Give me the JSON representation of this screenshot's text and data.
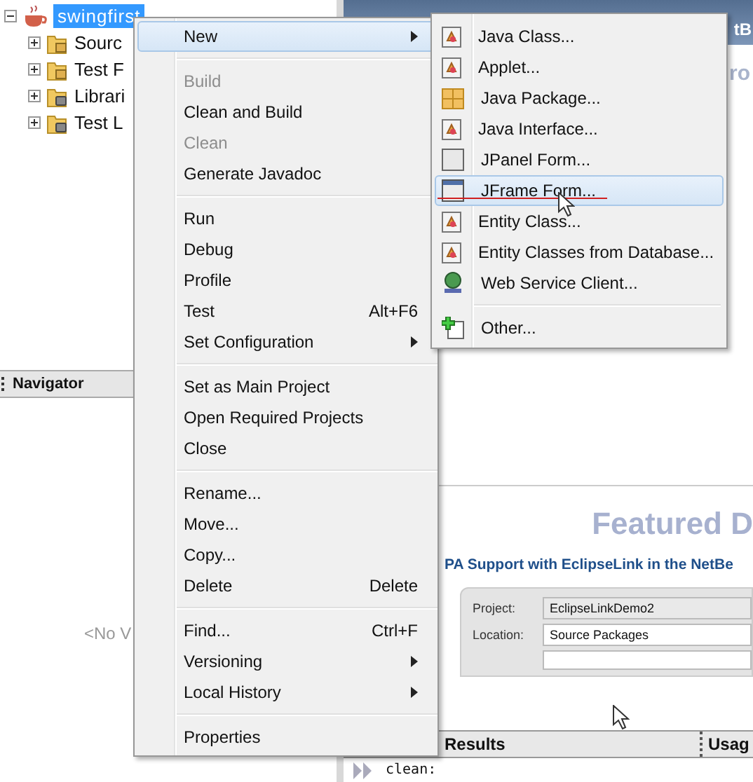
{
  "project_tree": {
    "root": {
      "label": "swingfirst",
      "selected": true,
      "expanded": true
    },
    "children": [
      {
        "kind": "packages",
        "label": "Sourc",
        "expanded": false
      },
      {
        "kind": "packages",
        "label": "Test F",
        "expanded": false
      },
      {
        "kind": "libraries",
        "label": "Librari",
        "expanded": false
      },
      {
        "kind": "libraries",
        "label": "Test L",
        "expanded": false
      }
    ]
  },
  "navigator": {
    "title": "Navigator",
    "empty_text": "<No V"
  },
  "editor": {
    "tab_text": "tB",
    "heading_fragment": "ro",
    "featured_heading": "Featured D",
    "article_title": "PA Support with EclipseLink in the NetBe",
    "form_preview": {
      "fields": [
        {
          "label": "Project:",
          "value": "EclipseLinkDemo2"
        },
        {
          "label": "Location:",
          "value": "Source Packages"
        }
      ]
    }
  },
  "output": {
    "tabs": [
      {
        "label": "Results"
      },
      {
        "label": "Usag"
      }
    ],
    "lines": [
      "clean:"
    ]
  },
  "context_menu": {
    "items": [
      {
        "kind": "item",
        "label": "New",
        "selected": true,
        "disabled": false,
        "submenu": true
      },
      {
        "kind": "separator"
      },
      {
        "kind": "item",
        "label": "Build",
        "selected": false,
        "disabled": true,
        "submenu": false
      },
      {
        "kind": "item",
        "label": "Clean and Build",
        "selected": false,
        "disabled": false,
        "submenu": false
      },
      {
        "kind": "item",
        "label": "Clean",
        "selected": false,
        "disabled": true,
        "submenu": false
      },
      {
        "kind": "item",
        "label": "Generate Javadoc",
        "selected": false,
        "disabled": false,
        "submenu": false
      },
      {
        "kind": "separator"
      },
      {
        "kind": "item",
        "label": "Run",
        "selected": false,
        "disabled": false,
        "submenu": false
      },
      {
        "kind": "item",
        "label": "Debug",
        "selected": false,
        "disabled": false,
        "submenu": false
      },
      {
        "kind": "item",
        "label": "Profile",
        "selected": false,
        "disabled": false,
        "submenu": false
      },
      {
        "kind": "item",
        "label": "Test",
        "shortcut": "Alt+F6",
        "selected": false,
        "disabled": false,
        "submenu": false
      },
      {
        "kind": "item",
        "label": "Set Configuration",
        "selected": false,
        "disabled": false,
        "submenu": true
      },
      {
        "kind": "separator"
      },
      {
        "kind": "item",
        "label": "Set as Main Project",
        "selected": false,
        "disabled": false,
        "submenu": false
      },
      {
        "kind": "item",
        "label": "Open Required Projects",
        "selected": false,
        "disabled": false,
        "submenu": false
      },
      {
        "kind": "item",
        "label": "Close",
        "selected": false,
        "disabled": false,
        "submenu": false
      },
      {
        "kind": "separator"
      },
      {
        "kind": "item",
        "label": "Rename...",
        "selected": false,
        "disabled": false,
        "submenu": false
      },
      {
        "kind": "item",
        "label": "Move...",
        "selected": false,
        "disabled": false,
        "submenu": false
      },
      {
        "kind": "item",
        "label": "Copy...",
        "selected": false,
        "disabled": false,
        "submenu": false
      },
      {
        "kind": "item",
        "label": "Delete",
        "shortcut": "Delete",
        "selected": false,
        "disabled": false,
        "submenu": false
      },
      {
        "kind": "separator"
      },
      {
        "kind": "item",
        "label": "Find...",
        "shortcut": "Ctrl+F",
        "selected": false,
        "disabled": false,
        "submenu": false
      },
      {
        "kind": "item",
        "label": "Versioning",
        "selected": false,
        "disabled": false,
        "submenu": true
      },
      {
        "kind": "item",
        "label": "Local History",
        "selected": false,
        "disabled": false,
        "submenu": true
      },
      {
        "kind": "separator"
      },
      {
        "kind": "item",
        "label": "Properties",
        "selected": false,
        "disabled": false,
        "submenu": false
      }
    ]
  },
  "new_submenu": {
    "items": [
      {
        "kind": "template",
        "label": "Java Class...",
        "selected": false
      },
      {
        "kind": "template",
        "label": "Applet...",
        "selected": false
      },
      {
        "kind": "package",
        "label": "Java Package...",
        "selected": false
      },
      {
        "kind": "template",
        "label": "Java Interface...",
        "selected": false
      },
      {
        "kind": "panel",
        "label": "JPanel Form...",
        "selected": false
      },
      {
        "kind": "frame",
        "label": "JFrame Form...",
        "selected": true
      },
      {
        "kind": "template",
        "label": "Entity Class...",
        "selected": false
      },
      {
        "kind": "template",
        "label": "Entity Classes from Database...",
        "selected": false
      },
      {
        "kind": "globe",
        "label": "Web Service Client...",
        "selected": false
      },
      {
        "kind": "separator"
      },
      {
        "kind": "add",
        "label": "Other...",
        "selected": false
      }
    ]
  }
}
